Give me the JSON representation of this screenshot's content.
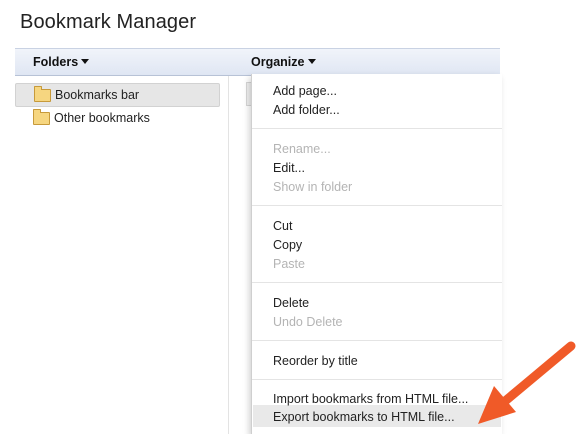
{
  "app": {
    "title": "Bookmark Manager"
  },
  "toolbar": {
    "folders_label": "Folders",
    "organize_label": "Organize"
  },
  "sidebar": {
    "items": [
      {
        "label": "Bookmarks bar",
        "selected": true
      },
      {
        "label": "Other bookmarks",
        "selected": false
      }
    ]
  },
  "organize_menu": {
    "items": [
      {
        "label": "Add page...",
        "enabled": true
      },
      {
        "label": "Add folder...",
        "enabled": true
      },
      {
        "label": "Rename...",
        "enabled": false
      },
      {
        "label": "Edit...",
        "enabled": true
      },
      {
        "label": "Show in folder",
        "enabled": false
      },
      {
        "label": "Cut",
        "enabled": true
      },
      {
        "label": "Copy",
        "enabled": true
      },
      {
        "label": "Paste",
        "enabled": false
      },
      {
        "label": "Delete",
        "enabled": true
      },
      {
        "label": "Undo Delete",
        "enabled": false
      },
      {
        "label": "Reorder by title",
        "enabled": true
      },
      {
        "label": "Import bookmarks from HTML file...",
        "enabled": true
      },
      {
        "label": "Export bookmarks to HTML file...",
        "enabled": true,
        "highlighted": true
      }
    ]
  },
  "colors": {
    "annotation_arrow": "#f05a28",
    "toolbar_bg": "#dfe6f3",
    "disabled_text": "#b4b4b4"
  },
  "icons": {
    "folder": "folder-icon",
    "caret": "caret-down-icon",
    "arrow": "pointer-arrow-icon"
  }
}
